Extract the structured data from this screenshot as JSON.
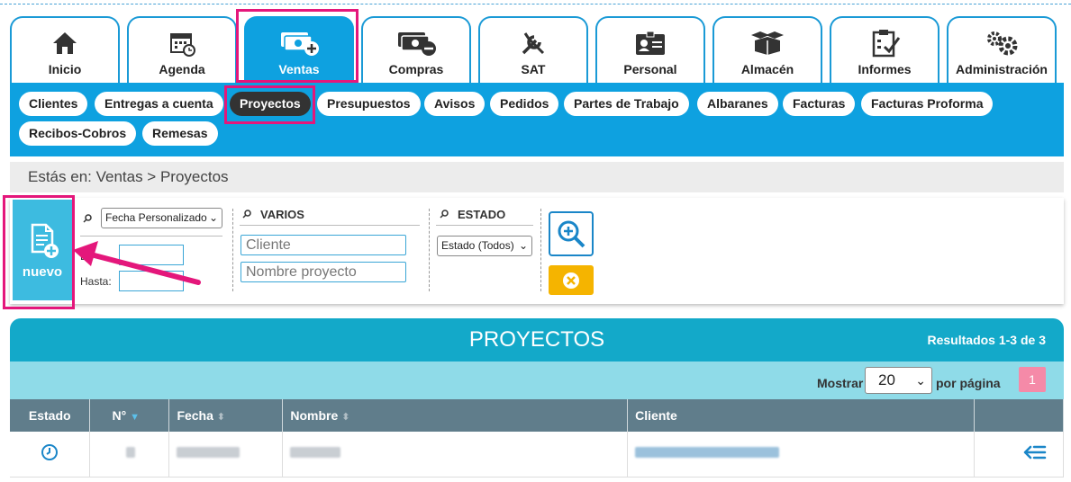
{
  "tabs": [
    {
      "label": "Inicio",
      "icon": "home-icon"
    },
    {
      "label": "Agenda",
      "icon": "calendar-icon"
    },
    {
      "label": "Ventas",
      "icon": "money-plus-icon",
      "active": true
    },
    {
      "label": "Compras",
      "icon": "money-minus-icon"
    },
    {
      "label": "SAT",
      "icon": "tools-icon"
    },
    {
      "label": "Personal",
      "icon": "id-card-icon"
    },
    {
      "label": "Almacén",
      "icon": "boxes-icon"
    },
    {
      "label": "Informes",
      "icon": "clipboard-check-icon"
    },
    {
      "label": "Administración",
      "icon": "gears-icon"
    }
  ],
  "subnav": {
    "row1": [
      "Clientes",
      "Entregas a cuenta",
      "Proyectos",
      "Presupuestos",
      "Avisos",
      "Pedidos",
      "Partes de Trabajo",
      "Albaranes",
      "Facturas",
      "Facturas Proforma"
    ],
    "row2": [
      "Recibos-Cobros",
      "Remesas"
    ],
    "active": "Proyectos"
  },
  "breadcrumb": "Estás en: Ventas > Proyectos",
  "filters": {
    "new_label": "nuevo",
    "date_select": "Fecha Personalizado",
    "desde_label": "De",
    "hasta_label": "Hasta:",
    "varios_title": "VARIOS",
    "cliente_placeholder": "Cliente",
    "nombre_placeholder": "Nombre proyecto",
    "estado_title": "ESTADO",
    "estado_select": "Estado (Todos)"
  },
  "results": {
    "title": "PROYECTOS",
    "count": "Resultados 1-3 de 3",
    "mostrar_label": "Mostrar",
    "per_page": "20",
    "por_pagina_label": "por página",
    "page": "1"
  },
  "table": {
    "headers": [
      "Estado",
      "N°",
      "Fecha",
      "Nombre",
      "Cliente",
      ""
    ]
  },
  "colors": {
    "accent": "#0ea1e0",
    "highlight": "#e4177b",
    "header": "#13a9c9"
  }
}
